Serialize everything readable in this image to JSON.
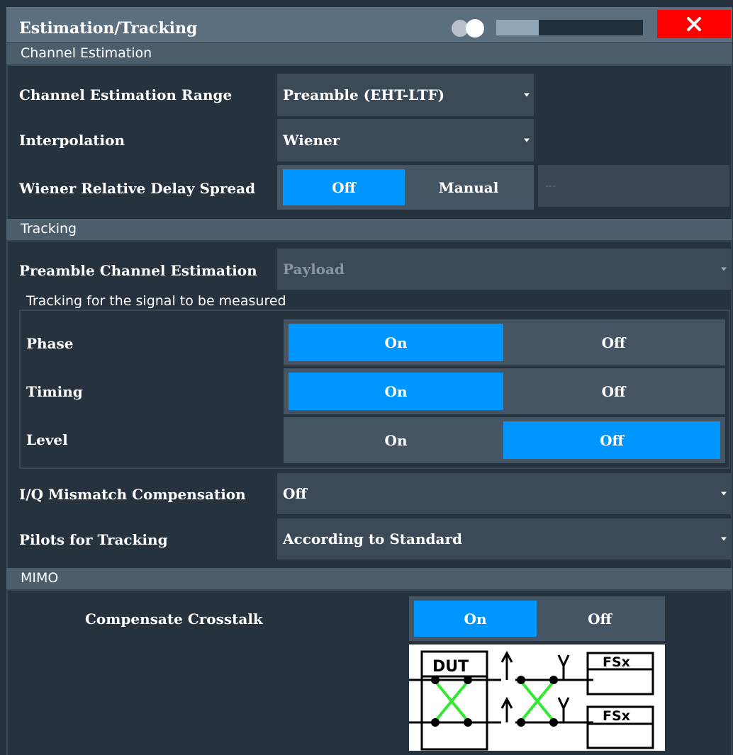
{
  "dialog": {
    "title": "Estimation/Tracking",
    "close_symbol": "✕",
    "progress_fraction": 0.29,
    "colors": {
      "active": "#0096ff",
      "close": "#ff0000",
      "title_bar": "#5b6f7f"
    }
  },
  "channel_estimation": {
    "section_label": "Channel Estimation",
    "range": {
      "label": "Channel Estimation Range",
      "value": "Preamble (EHT-LTF)"
    },
    "interpolation": {
      "label": "Interpolation",
      "value": "Wiener"
    },
    "delay_spread": {
      "label": "Wiener Relative Delay Spread",
      "options": [
        "Off",
        "Manual"
      ],
      "selected": "Off",
      "field_value": "---"
    }
  },
  "tracking": {
    "section_label": "Tracking",
    "preamble": {
      "label": "Preamble Channel Estimation",
      "value": "Payload"
    },
    "group_label": "Tracking for the signal to be measured",
    "phase": {
      "label": "Phase",
      "on": "On",
      "off": "Off",
      "selected": "On"
    },
    "timing": {
      "label": "Timing",
      "on": "On",
      "off": "Off",
      "selected": "On"
    },
    "level": {
      "label": "Level",
      "on": "On",
      "off": "Off",
      "selected": "Off"
    },
    "iq_mismatch": {
      "label": "I/Q Mismatch Compensation",
      "value": "Off"
    },
    "pilots": {
      "label": "Pilots for Tracking",
      "value": "According to Standard"
    }
  },
  "mimo": {
    "section_label": "MIMO",
    "crosstalk": {
      "label": "Compensate Crosstalk",
      "on": "On",
      "off": "Off",
      "selected": "On"
    },
    "diagram": {
      "dut_label": "DUT",
      "fsx_label_1": "FSx",
      "fsx_label_2": "FSx"
    }
  }
}
